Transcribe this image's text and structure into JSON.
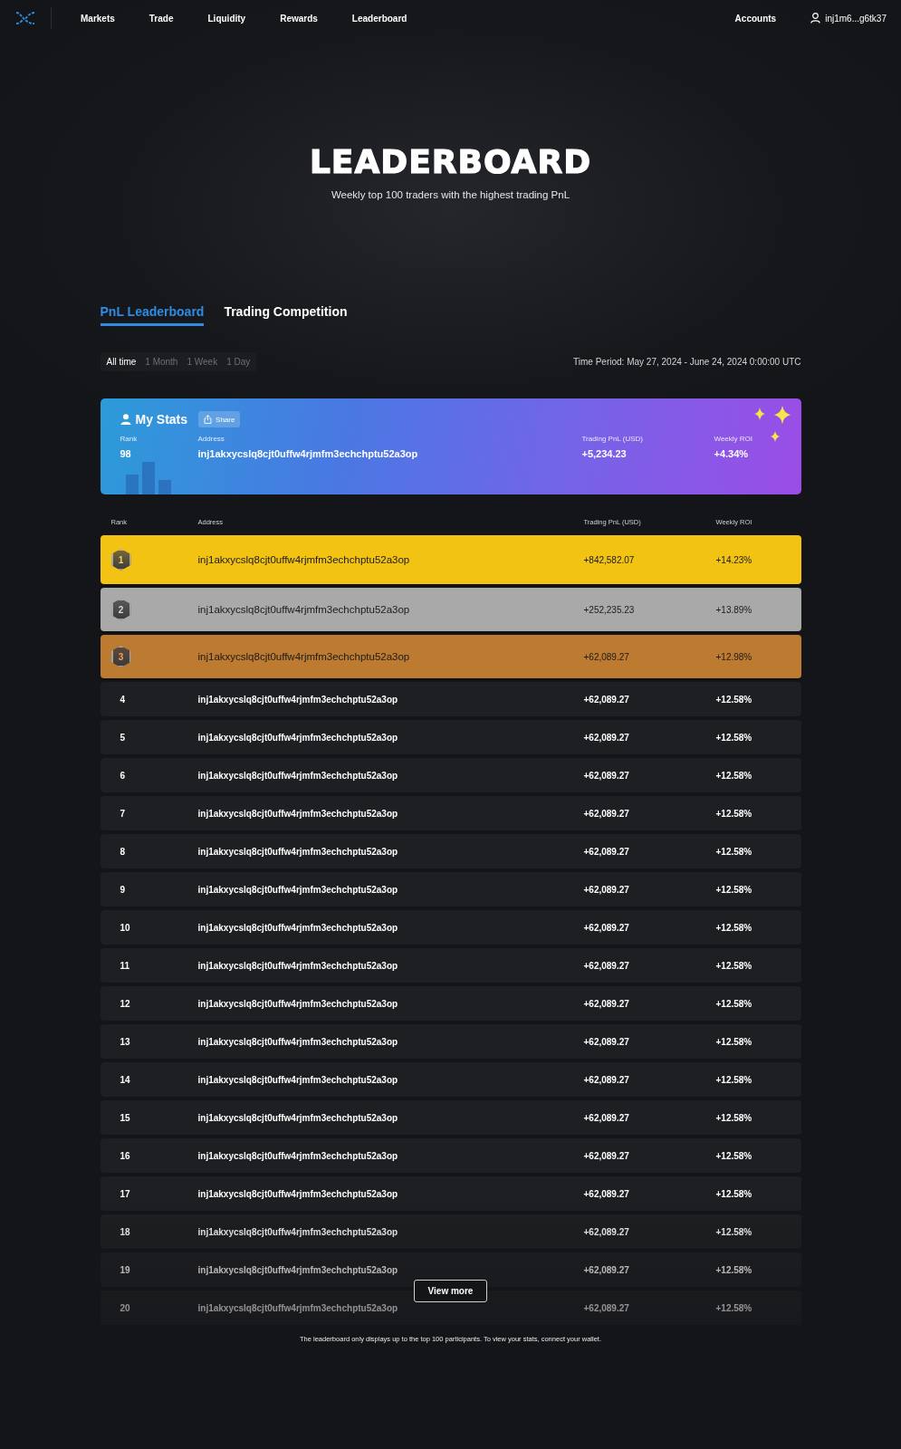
{
  "nav": {
    "links": [
      {
        "label": "Markets"
      },
      {
        "label": "Trade"
      },
      {
        "label": "Liquidity"
      },
      {
        "label": "Rewards"
      },
      {
        "label": "Leaderboard"
      }
    ],
    "accounts": "Accounts",
    "wallet": "inj1m6...g6tk37"
  },
  "hero": {
    "title": "LEADERBOARD",
    "subtitle": "Weekly top 100 traders with the highest trading PnL"
  },
  "tabs": [
    {
      "label": "PnL Leaderboard",
      "selected": true
    },
    {
      "label": "Trading Competition",
      "selected": false
    }
  ],
  "periods": [
    {
      "label": "All time",
      "selected": true
    },
    {
      "label": "1 Month",
      "selected": false
    },
    {
      "label": "1 Week",
      "selected": false
    },
    {
      "label": "1 Day",
      "selected": false
    }
  ],
  "time_period": "Time Period: May 27, 2024 - June 24, 2024 0:00:00 UTC",
  "my_stats": {
    "title": "My Stats",
    "share": "Share",
    "labels": [
      "Rank",
      "Address",
      "Trading PnL (USD)",
      "Weekly ROI"
    ],
    "rank": "98",
    "address": "inj1akxycslq8cjt0uffw4rjmfm3echchptu52a3op",
    "pnl": "+5,234.23",
    "roi": "+4.34%"
  },
  "table": {
    "columns": [
      "Rank",
      "Address",
      "Trading PnL (USD)",
      "Weekly ROI"
    ],
    "rows": [
      {
        "kind": "gold",
        "rank": "1",
        "address": "inj1akxycslq8cjt0uffw4rjmfm3echchptu52a3op",
        "pnl": "+842,582.07",
        "roi": "+14.23%"
      },
      {
        "kind": "silver",
        "rank": "2",
        "address": "inj1akxycslq8cjt0uffw4rjmfm3echchptu52a3op",
        "pnl": "+252,235.23",
        "roi": "+13.89%"
      },
      {
        "kind": "bronze",
        "rank": "3",
        "address": "inj1akxycslq8cjt0uffw4rjmfm3echchptu52a3op",
        "pnl": "+62,089.27",
        "roi": "+12.98%"
      },
      {
        "kind": "plain",
        "rank": "4",
        "address": "inj1akxycslq8cjt0uffw4rjmfm3echchptu52a3op",
        "pnl": "+62,089.27",
        "roi": "+12.58%"
      },
      {
        "kind": "plain",
        "rank": "5",
        "address": "inj1akxycslq8cjt0uffw4rjmfm3echchptu52a3op",
        "pnl": "+62,089.27",
        "roi": "+12.58%"
      },
      {
        "kind": "plain",
        "rank": "6",
        "address": "inj1akxycslq8cjt0uffw4rjmfm3echchptu52a3op",
        "pnl": "+62,089.27",
        "roi": "+12.58%"
      },
      {
        "kind": "plain",
        "rank": "7",
        "address": "inj1akxycslq8cjt0uffw4rjmfm3echchptu52a3op",
        "pnl": "+62,089.27",
        "roi": "+12.58%"
      },
      {
        "kind": "plain",
        "rank": "8",
        "address": "inj1akxycslq8cjt0uffw4rjmfm3echchptu52a3op",
        "pnl": "+62,089.27",
        "roi": "+12.58%"
      },
      {
        "kind": "plain",
        "rank": "9",
        "address": "inj1akxycslq8cjt0uffw4rjmfm3echchptu52a3op",
        "pnl": "+62,089.27",
        "roi": "+12.58%"
      },
      {
        "kind": "plain",
        "rank": "10",
        "address": "inj1akxycslq8cjt0uffw4rjmfm3echchptu52a3op",
        "pnl": "+62,089.27",
        "roi": "+12.58%"
      },
      {
        "kind": "plain",
        "rank": "11",
        "address": "inj1akxycslq8cjt0uffw4rjmfm3echchptu52a3op",
        "pnl": "+62,089.27",
        "roi": "+12.58%"
      },
      {
        "kind": "plain",
        "rank": "12",
        "address": "inj1akxycslq8cjt0uffw4rjmfm3echchptu52a3op",
        "pnl": "+62,089.27",
        "roi": "+12.58%"
      },
      {
        "kind": "plain",
        "rank": "13",
        "address": "inj1akxycslq8cjt0uffw4rjmfm3echchptu52a3op",
        "pnl": "+62,089.27",
        "roi": "+12.58%"
      },
      {
        "kind": "plain",
        "rank": "14",
        "address": "inj1akxycslq8cjt0uffw4rjmfm3echchptu52a3op",
        "pnl": "+62,089.27",
        "roi": "+12.58%"
      },
      {
        "kind": "plain",
        "rank": "15",
        "address": "inj1akxycslq8cjt0uffw4rjmfm3echchptu52a3op",
        "pnl": "+62,089.27",
        "roi": "+12.58%"
      },
      {
        "kind": "plain",
        "rank": "16",
        "address": "inj1akxycslq8cjt0uffw4rjmfm3echchptu52a3op",
        "pnl": "+62,089.27",
        "roi": "+12.58%"
      },
      {
        "kind": "plain",
        "rank": "17",
        "address": "inj1akxycslq8cjt0uffw4rjmfm3echchptu52a3op",
        "pnl": "+62,089.27",
        "roi": "+12.58%"
      },
      {
        "kind": "plain",
        "rank": "18",
        "address": "inj1akxycslq8cjt0uffw4rjmfm3echchptu52a3op",
        "pnl": "+62,089.27",
        "roi": "+12.58%"
      },
      {
        "kind": "plain",
        "rank": "19",
        "address": "inj1akxycslq8cjt0uffw4rjmfm3echchptu52a3op",
        "pnl": "+62,089.27",
        "roi": "+12.58%"
      },
      {
        "kind": "plain",
        "rank": "20",
        "address": "inj1akxycslq8cjt0uffw4rjmfm3echchptu52a3op",
        "pnl": "+62,089.27",
        "roi": "+12.58%"
      }
    ]
  },
  "view_more": "View more",
  "footnote": "The leaderboard only displays up to the top 100 participants. To view your stats, connect your wallet."
}
